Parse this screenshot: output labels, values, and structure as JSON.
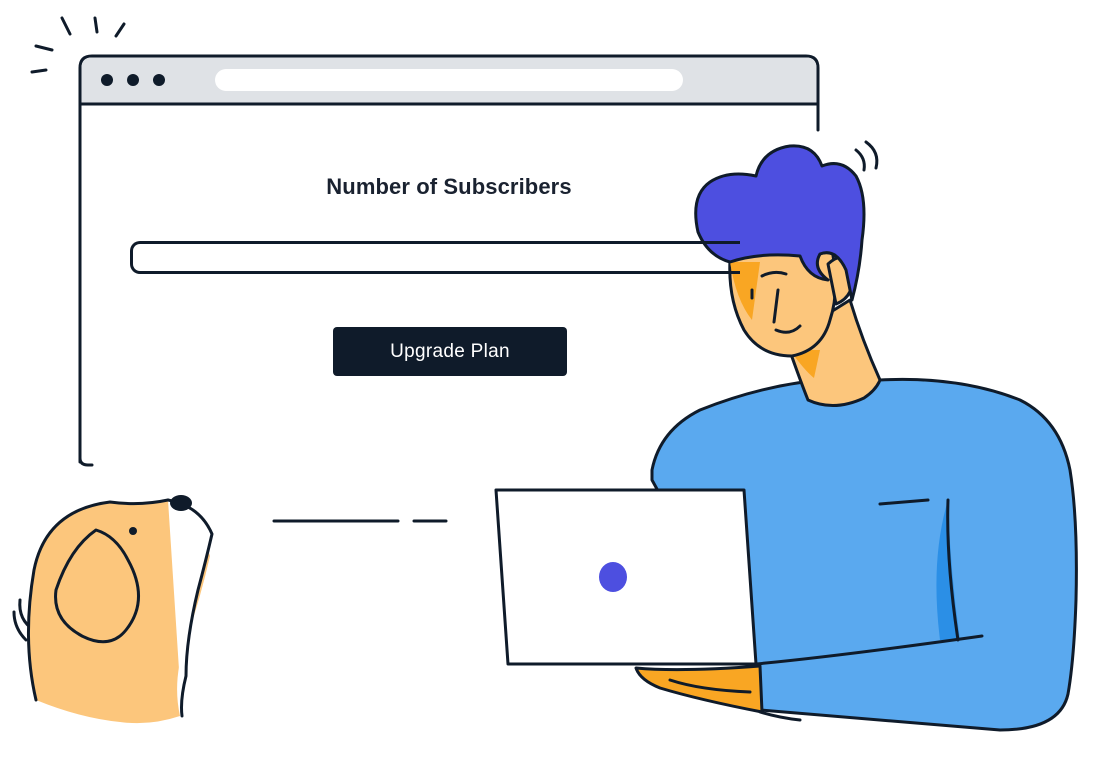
{
  "browser": {
    "title": "Number of Subscribers",
    "input_value": "",
    "button_label": "Upgrade Plan"
  },
  "colors": {
    "outline": "#0f1b2a",
    "browser_bar": "#dfe2e6",
    "hair": "#4d4fe0",
    "skin": "#fcc67c",
    "skin_shadow": "#f9a623",
    "shirt": "#5aa9ef",
    "shirt_shadow": "#2b8fe6",
    "laptop_dot": "#4d4fe0",
    "button_bg": "#0f1b2a",
    "button_text": "#ffffff"
  },
  "icons": [
    "window-dot-icon",
    "window-dot-icon",
    "window-dot-icon",
    "sparkle-lines-icon",
    "motion-lines-icon"
  ]
}
